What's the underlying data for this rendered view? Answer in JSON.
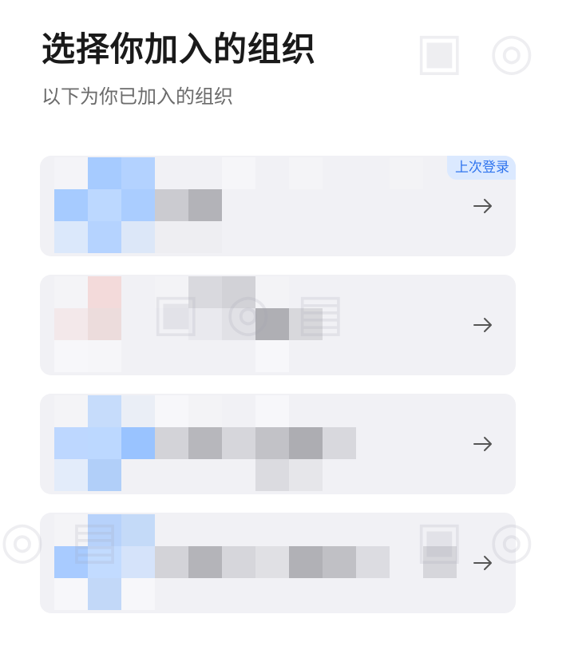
{
  "header": {
    "title": "选择你加入的组织",
    "subtitle": "以下为你已加入的组织"
  },
  "org_list": [
    {
      "badge": "上次登录",
      "icon": "arrow-right-icon",
      "mosaic": [
        [
          "#f4f4f8",
          "#a6cbff",
          "#b3d2ff",
          "#f1f1f5",
          "#f1f1f5",
          "#f6f6f9",
          "#f1f1f5",
          "#f4f4f7",
          "#f1f1f5",
          "#f1f1f5",
          "#f3f3f6",
          "#f1f1f5"
        ],
        [
          "#a6cbff",
          "#bcd8ff",
          "#aacdff",
          "#cbcbd0",
          "#b3b3b8",
          "#f1f1f5",
          "#f1f1f5",
          "#f1f1f5",
          "#f1f1f5",
          "#f1f1f5",
          "#f1f1f5",
          "#f1f1f5"
        ],
        [
          "#dbe8fb",
          "#b5d3ff",
          "#dce7f8",
          "#eeeef2",
          "#eeeef2",
          "#f1f1f5",
          "#f1f1f5",
          "#f1f1f5",
          "#f1f1f5",
          "#f1f1f5",
          "#f1f1f5",
          "#f1f1f5"
        ]
      ]
    },
    {
      "badge": "",
      "icon": "arrow-right-icon",
      "mosaic": [
        [
          "#f4f4f7",
          "#f3dada",
          "#f1f1f5",
          "#f3f3f6",
          "#d9d9de",
          "#d2d2d7",
          "#f3f3f6",
          "#f1f1f5",
          "#f1f1f5",
          "#f1f1f5",
          "#f1f1f5",
          "#f1f1f5"
        ],
        [
          "#f3e8ea",
          "#ecdcdc",
          "#f1f1f5",
          "#f1f1f5",
          "#e9e9ee",
          "#e1e1e6",
          "#afafb4",
          "#d8d8dc",
          "#f1f1f5",
          "#f1f1f5",
          "#f1f1f5",
          "#f1f1f5"
        ],
        [
          "#f7f7fa",
          "#f6f6f9",
          "#f1f1f5",
          "#f1f1f5",
          "#f1f1f5",
          "#f1f1f5",
          "#f7f7fa",
          "#f1f1f5",
          "#f1f1f5",
          "#f1f1f5",
          "#f1f1f5",
          "#f1f1f5"
        ]
      ]
    },
    {
      "badge": "",
      "icon": "arrow-right-icon",
      "mosaic": [
        [
          "#f4f4f7",
          "#c6dcfb",
          "#eaeef6",
          "#f7f7fa",
          "#f3f3f6",
          "#f1f1f5",
          "#f7f7fa",
          "#f1f1f5",
          "#f1f1f5",
          "#f1f1f5",
          "#f1f1f5",
          "#f1f1f5"
        ],
        [
          "#bdd7ff",
          "#bcd8ff",
          "#99c3ff",
          "#d3d3d8",
          "#b7b7bc",
          "#d6d6db",
          "#c2c2c7",
          "#adadb2",
          "#d8d8dd",
          "#f1f1f5",
          "#f1f1f5",
          "#f1f1f5"
        ],
        [
          "#e3ecfa",
          "#b1cff9",
          "#f1f1f5",
          "#f1f1f5",
          "#f1f1f5",
          "#f1f1f5",
          "#dbdbe0",
          "#e6e6ea",
          "#f1f1f5",
          "#f1f1f5",
          "#f1f1f5",
          "#f1f1f5"
        ]
      ]
    },
    {
      "badge": "",
      "icon": "arrow-right-icon",
      "mosaic": [
        [
          "#f4f4f7",
          "#b7d2fb",
          "#c4daf8",
          "#f1f1f5",
          "#f1f1f5",
          "#f1f1f5",
          "#f1f1f5",
          "#f1f1f5",
          "#f1f1f5",
          "#f1f1f5",
          "#f1f1f5",
          "#f1f1f5"
        ],
        [
          "#a8cbff",
          "#c2dbff",
          "#d5e3fa",
          "#d3d3d8",
          "#b4b4b9",
          "#d6d6db",
          "#e0e0e4",
          "#b1b1b6",
          "#c0c0c5",
          "#dcdce1",
          "#f1f1f5",
          "#d6d6db"
        ],
        [
          "#f7f7fa",
          "#c2d8f8",
          "#f7f7fa",
          "#f1f1f5",
          "#f1f1f5",
          "#f1f1f5",
          "#f1f1f5",
          "#f1f1f5",
          "#f1f1f5",
          "#f1f1f5",
          "#f1f1f5",
          "#f1f1f5"
        ]
      ]
    }
  ]
}
